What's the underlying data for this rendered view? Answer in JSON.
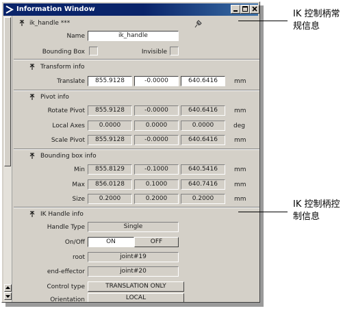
{
  "window": {
    "title": "Information Window",
    "minimize": "minimize",
    "maximize": "maximize",
    "close": "close"
  },
  "general": {
    "header": "ik_handle ***",
    "name_label": "Name",
    "name_value": "ik_handle",
    "bounding_box_label": "Bounding Box",
    "invisible_label": "Invisible"
  },
  "transform": {
    "header": "Transform info",
    "translate_label": "Translate",
    "translate": [
      "855.9128",
      "-0.0000",
      "640.6416"
    ],
    "unit": "mm"
  },
  "pivot": {
    "header": "Pivot info",
    "rotate_label": "Rotate Pivot",
    "rotate": [
      "855.9128",
      "-0.0000",
      "640.6416"
    ],
    "rotate_unit": "mm",
    "local_label": "Local Axes",
    "local": [
      "0.0000",
      "0.0000",
      "0.0000"
    ],
    "local_unit": "deg",
    "scale_label": "Scale Pivot",
    "scale": [
      "855.9128",
      "-0.0000",
      "640.6416"
    ],
    "scale_unit": "mm"
  },
  "bbox": {
    "header": "Bounding box info",
    "min_label": "Min",
    "min": [
      "855.8129",
      "-0.1000",
      "640.5416"
    ],
    "min_unit": "mm",
    "max_label": "Max",
    "max": [
      "856.0128",
      "0.1000",
      "640.7416"
    ],
    "max_unit": "mm",
    "size_label": "Size",
    "size": [
      "0.2000",
      "0.2000",
      "0.2000"
    ],
    "size_unit": "mm"
  },
  "ik": {
    "header": "IK Handle info",
    "handle_type_label": "Handle Type",
    "handle_type": "Single",
    "onoff_label": "On/Off",
    "on": "ON",
    "off": "OFF",
    "root_label": "root",
    "root": "joint#19",
    "effector_label": "end-effector",
    "effector": "joint#20",
    "control_label": "Control type",
    "control": "TRANSLATION ONLY",
    "orientation_label": "Orientation",
    "orientation": "LOCAL"
  },
  "annotations": {
    "general_line1": "IK 控制柄常",
    "general_line2": "规信息",
    "ik_line1": "IK 控制柄控",
    "ik_line2": "制信息"
  },
  "icons": [
    "window-icon",
    "pin-icon",
    "collapse-arrow-icon",
    "scroll-up-icon",
    "scroll-down-icon"
  ]
}
